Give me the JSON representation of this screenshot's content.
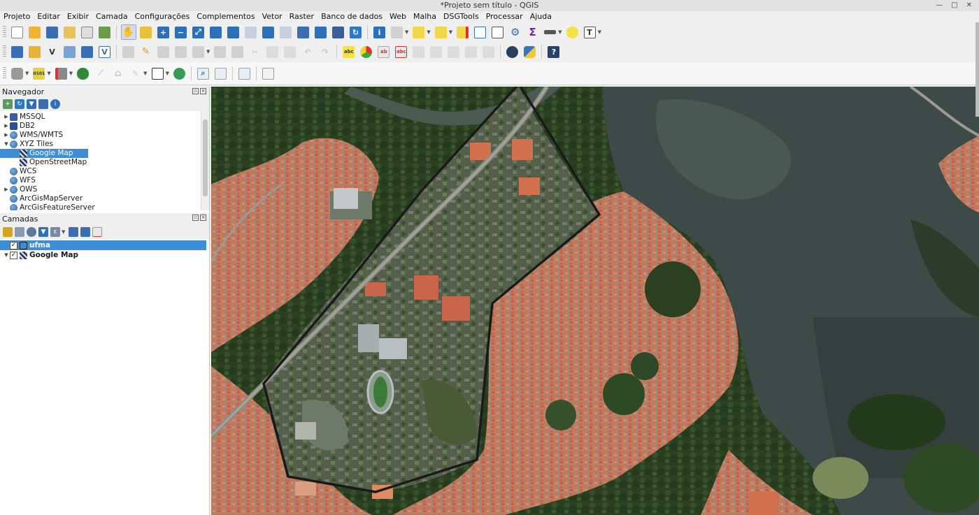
{
  "window": {
    "title": "*Projeto sem título - QGIS"
  },
  "menu": [
    "Projeto",
    "Editar",
    "Exibir",
    "Camada",
    "Configurações",
    "Complementos",
    "Vetor",
    "Raster",
    "Banco de dados",
    "Web",
    "Malha",
    "DSGTools",
    "Processar",
    "Ajuda"
  ],
  "navigator": {
    "title": "Navegador",
    "items": [
      {
        "label": "MSSQL",
        "icon": "mssql-icon",
        "expandable": true,
        "expanded": false,
        "indent": 0
      },
      {
        "label": "DB2",
        "icon": "db2-icon",
        "expandable": true,
        "expanded": false,
        "indent": 0
      },
      {
        "label": "WMS/WMTS",
        "icon": "wms-globe-icon",
        "expandable": true,
        "expanded": false,
        "indent": 0
      },
      {
        "label": "XYZ Tiles",
        "icon": "xyz-globe-icon",
        "expandable": true,
        "expanded": true,
        "indent": 0
      },
      {
        "label": "Google Map",
        "icon": "tile-layer-icon",
        "expandable": false,
        "indent": 1,
        "selected": true
      },
      {
        "label": "OpenStreetMap",
        "icon": "tile-layer-icon",
        "expandable": false,
        "indent": 1
      },
      {
        "label": "WCS",
        "icon": "wcs-globe-icon",
        "expandable": false,
        "indent": 0
      },
      {
        "label": "WFS",
        "icon": "wfs-globe-icon",
        "expandable": false,
        "indent": 0
      },
      {
        "label": "OWS",
        "icon": "ows-globe-icon",
        "expandable": true,
        "expanded": false,
        "indent": 0
      },
      {
        "label": "ArcGisMapServer",
        "icon": "arcgis-globe-icon",
        "expandable": false,
        "indent": 0
      },
      {
        "label": "ArcGisFeatureServer",
        "icon": "arcgis-globe-icon",
        "expandable": false,
        "indent": 0
      }
    ]
  },
  "layers": {
    "title": "Camadas",
    "items": [
      {
        "label": "ufma",
        "checked": true,
        "selected": true,
        "bold": true,
        "expandable": false
      },
      {
        "label": "Google Map",
        "checked": true,
        "selected": false,
        "bold": true,
        "expandable": true
      }
    ]
  },
  "colors": {
    "selection": "#3d8ed8",
    "polygon_outline": "#1a1a1a",
    "roof": "#c96a4a",
    "vegetation": "#2f4a22",
    "water": "#3c4a46"
  }
}
